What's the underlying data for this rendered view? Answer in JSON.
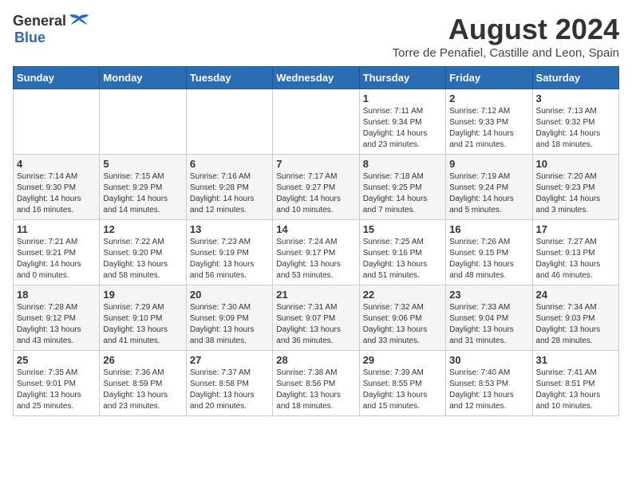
{
  "header": {
    "logo_general": "General",
    "logo_blue": "Blue",
    "month_year": "August 2024",
    "location": "Torre de Penafiel, Castille and Leon, Spain"
  },
  "days_of_week": [
    "Sunday",
    "Monday",
    "Tuesday",
    "Wednesday",
    "Thursday",
    "Friday",
    "Saturday"
  ],
  "weeks": [
    [
      {
        "day": "",
        "sunrise": "",
        "sunset": "",
        "daylight": ""
      },
      {
        "day": "",
        "sunrise": "",
        "sunset": "",
        "daylight": ""
      },
      {
        "day": "",
        "sunrise": "",
        "sunset": "",
        "daylight": ""
      },
      {
        "day": "",
        "sunrise": "",
        "sunset": "",
        "daylight": ""
      },
      {
        "day": "1",
        "sunrise": "Sunrise: 7:11 AM",
        "sunset": "Sunset: 9:34 PM",
        "daylight": "Daylight: 14 hours and 23 minutes."
      },
      {
        "day": "2",
        "sunrise": "Sunrise: 7:12 AM",
        "sunset": "Sunset: 9:33 PM",
        "daylight": "Daylight: 14 hours and 21 minutes."
      },
      {
        "day": "3",
        "sunrise": "Sunrise: 7:13 AM",
        "sunset": "Sunset: 9:32 PM",
        "daylight": "Daylight: 14 hours and 18 minutes."
      }
    ],
    [
      {
        "day": "4",
        "sunrise": "Sunrise: 7:14 AM",
        "sunset": "Sunset: 9:30 PM",
        "daylight": "Daylight: 14 hours and 16 minutes."
      },
      {
        "day": "5",
        "sunrise": "Sunrise: 7:15 AM",
        "sunset": "Sunset: 9:29 PM",
        "daylight": "Daylight: 14 hours and 14 minutes."
      },
      {
        "day": "6",
        "sunrise": "Sunrise: 7:16 AM",
        "sunset": "Sunset: 9:28 PM",
        "daylight": "Daylight: 14 hours and 12 minutes."
      },
      {
        "day": "7",
        "sunrise": "Sunrise: 7:17 AM",
        "sunset": "Sunset: 9:27 PM",
        "daylight": "Daylight: 14 hours and 10 minutes."
      },
      {
        "day": "8",
        "sunrise": "Sunrise: 7:18 AM",
        "sunset": "Sunset: 9:25 PM",
        "daylight": "Daylight: 14 hours and 7 minutes."
      },
      {
        "day": "9",
        "sunrise": "Sunrise: 7:19 AM",
        "sunset": "Sunset: 9:24 PM",
        "daylight": "Daylight: 14 hours and 5 minutes."
      },
      {
        "day": "10",
        "sunrise": "Sunrise: 7:20 AM",
        "sunset": "Sunset: 9:23 PM",
        "daylight": "Daylight: 14 hours and 3 minutes."
      }
    ],
    [
      {
        "day": "11",
        "sunrise": "Sunrise: 7:21 AM",
        "sunset": "Sunset: 9:21 PM",
        "daylight": "Daylight: 14 hours and 0 minutes."
      },
      {
        "day": "12",
        "sunrise": "Sunrise: 7:22 AM",
        "sunset": "Sunset: 9:20 PM",
        "daylight": "Daylight: 13 hours and 58 minutes."
      },
      {
        "day": "13",
        "sunrise": "Sunrise: 7:23 AM",
        "sunset": "Sunset: 9:19 PM",
        "daylight": "Daylight: 13 hours and 56 minutes."
      },
      {
        "day": "14",
        "sunrise": "Sunrise: 7:24 AM",
        "sunset": "Sunset: 9:17 PM",
        "daylight": "Daylight: 13 hours and 53 minutes."
      },
      {
        "day": "15",
        "sunrise": "Sunrise: 7:25 AM",
        "sunset": "Sunset: 9:16 PM",
        "daylight": "Daylight: 13 hours and 51 minutes."
      },
      {
        "day": "16",
        "sunrise": "Sunrise: 7:26 AM",
        "sunset": "Sunset: 9:15 PM",
        "daylight": "Daylight: 13 hours and 48 minutes."
      },
      {
        "day": "17",
        "sunrise": "Sunrise: 7:27 AM",
        "sunset": "Sunset: 9:13 PM",
        "daylight": "Daylight: 13 hours and 46 minutes."
      }
    ],
    [
      {
        "day": "18",
        "sunrise": "Sunrise: 7:28 AM",
        "sunset": "Sunset: 9:12 PM",
        "daylight": "Daylight: 13 hours and 43 minutes."
      },
      {
        "day": "19",
        "sunrise": "Sunrise: 7:29 AM",
        "sunset": "Sunset: 9:10 PM",
        "daylight": "Daylight: 13 hours and 41 minutes."
      },
      {
        "day": "20",
        "sunrise": "Sunrise: 7:30 AM",
        "sunset": "Sunset: 9:09 PM",
        "daylight": "Daylight: 13 hours and 38 minutes."
      },
      {
        "day": "21",
        "sunrise": "Sunrise: 7:31 AM",
        "sunset": "Sunset: 9:07 PM",
        "daylight": "Daylight: 13 hours and 36 minutes."
      },
      {
        "day": "22",
        "sunrise": "Sunrise: 7:32 AM",
        "sunset": "Sunset: 9:06 PM",
        "daylight": "Daylight: 13 hours and 33 minutes."
      },
      {
        "day": "23",
        "sunrise": "Sunrise: 7:33 AM",
        "sunset": "Sunset: 9:04 PM",
        "daylight": "Daylight: 13 hours and 31 minutes."
      },
      {
        "day": "24",
        "sunrise": "Sunrise: 7:34 AM",
        "sunset": "Sunset: 9:03 PM",
        "daylight": "Daylight: 13 hours and 28 minutes."
      }
    ],
    [
      {
        "day": "25",
        "sunrise": "Sunrise: 7:35 AM",
        "sunset": "Sunset: 9:01 PM",
        "daylight": "Daylight: 13 hours and 25 minutes."
      },
      {
        "day": "26",
        "sunrise": "Sunrise: 7:36 AM",
        "sunset": "Sunset: 8:59 PM",
        "daylight": "Daylight: 13 hours and 23 minutes."
      },
      {
        "day": "27",
        "sunrise": "Sunrise: 7:37 AM",
        "sunset": "Sunset: 8:58 PM",
        "daylight": "Daylight: 13 hours and 20 minutes."
      },
      {
        "day": "28",
        "sunrise": "Sunrise: 7:38 AM",
        "sunset": "Sunset: 8:56 PM",
        "daylight": "Daylight: 13 hours and 18 minutes."
      },
      {
        "day": "29",
        "sunrise": "Sunrise: 7:39 AM",
        "sunset": "Sunset: 8:55 PM",
        "daylight": "Daylight: 13 hours and 15 minutes."
      },
      {
        "day": "30",
        "sunrise": "Sunrise: 7:40 AM",
        "sunset": "Sunset: 8:53 PM",
        "daylight": "Daylight: 13 hours and 12 minutes."
      },
      {
        "day": "31",
        "sunrise": "Sunrise: 7:41 AM",
        "sunset": "Sunset: 8:51 PM",
        "daylight": "Daylight: 13 hours and 10 minutes."
      }
    ]
  ]
}
